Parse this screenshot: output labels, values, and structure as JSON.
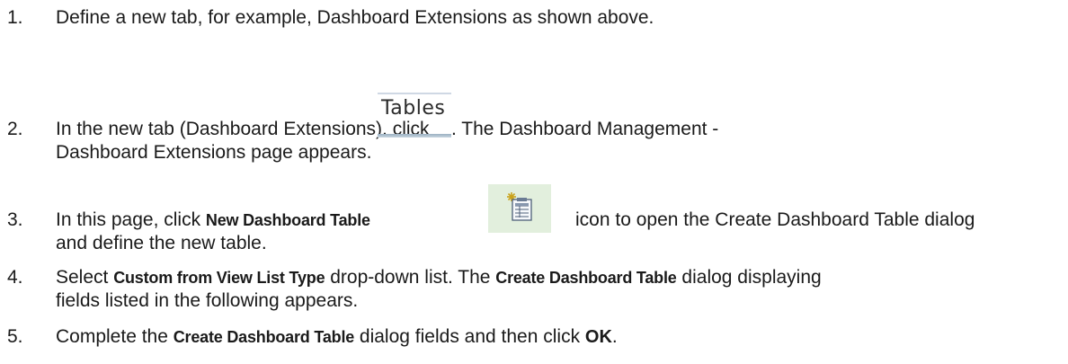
{
  "steps": [
    {
      "number": "1.",
      "text": "Define a new tab, for example, Dashboard Extensions as shown above."
    },
    {
      "number": "2.",
      "text_before": "In the new tab (Dashboard Extensions), click ",
      "text_after": ". The Dashboard Management -",
      "line2": "Dashboard Extensions page appears.",
      "tab_label": "Tables"
    },
    {
      "number": "3.",
      "text_before": "In this page, click ",
      "bold": "New Dashboard Table",
      "text_after": "icon to open the Create Dashboard Table dialog",
      "line2": "and define the new table.",
      "icon": "new-table-icon"
    },
    {
      "number": "4.",
      "text_before": "Select ",
      "bold": "Custom from View List Type",
      "text_mid": " drop-down list. The ",
      "bold2": "Create Dashboard Table",
      "text_after": " dialog displaying",
      "line2": "fields listed in the following appears."
    },
    {
      "number": "5.",
      "text_before": "Complete the ",
      "bold": "Create Dashboard Table",
      "text_mid": " dialog fields and then click ",
      "bold2": "OK",
      "text_after": "."
    }
  ],
  "colors": {
    "text": "#1a1a1a",
    "icon_tile_bg": "#e2efdd",
    "tab_underline": "#9bb0c2"
  }
}
